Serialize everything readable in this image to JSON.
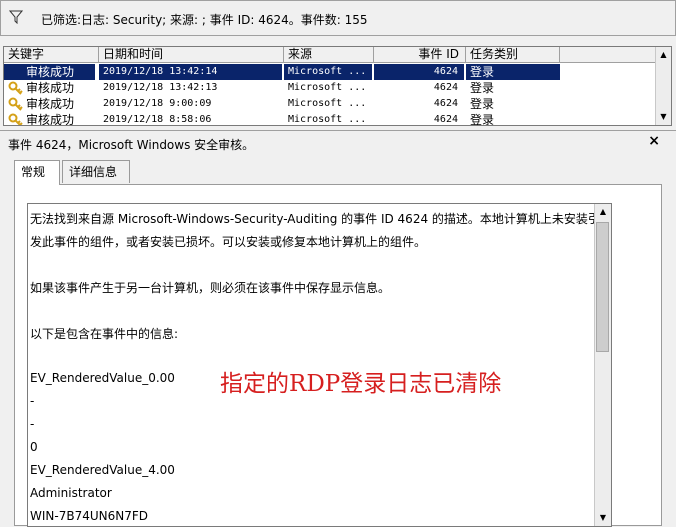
{
  "filter": {
    "text": "已筛选:日志: Security; 来源: ; 事件 ID: 4624。事件数: 155",
    "icon": "filter-icon"
  },
  "events": {
    "columns": [
      "关键字",
      "日期和时间",
      "来源",
      "事件 ID",
      "任务类别"
    ],
    "rows": [
      {
        "keyword": "审核成功",
        "date": "2019/12/18 13:42:14",
        "source": "Microsoft ...",
        "id": "4624",
        "category": "登录",
        "selected": true
      },
      {
        "keyword": "审核成功",
        "date": "2019/12/18 13:42:13",
        "source": "Microsoft ...",
        "id": "4624",
        "category": "登录"
      },
      {
        "keyword": "审核成功",
        "date": "2019/12/18 9:00:09",
        "source": "Microsoft ...",
        "id": "4624",
        "category": "登录"
      },
      {
        "keyword": "审核成功",
        "date": "2019/12/18 8:58:06",
        "source": "Microsoft ...",
        "id": "4624",
        "category": "登录"
      }
    ]
  },
  "detail": {
    "title": "事件 4624，Microsoft Windows 安全审核。",
    "close": "×",
    "tabs": [
      "常规",
      "详细信息"
    ],
    "lines": [
      "无法找到来自源 Microsoft-Windows-Security-Auditing 的事件 ID 4624 的描述。本地计算机上未安装引",
      "发此事件的组件，或者安装已损坏。可以安装或修复本地计算机上的组件。",
      "",
      "如果该事件产生于另一台计算机，则必须在该事件中保存显示信息。",
      "",
      "以下是包含在事件中的信息:",
      "",
      "EV_RenderedValue_0.00",
      "-",
      "-",
      "0",
      "EV_RenderedValue_4.00",
      "Administrator",
      "WIN-7B74UN6N7FD"
    ]
  },
  "overlay": {
    "text": "指定的RDP登录日志已清除",
    "color": "#d61f1f"
  },
  "colors": {
    "selection": "#0a246a",
    "key_icon": "#d4a017"
  }
}
